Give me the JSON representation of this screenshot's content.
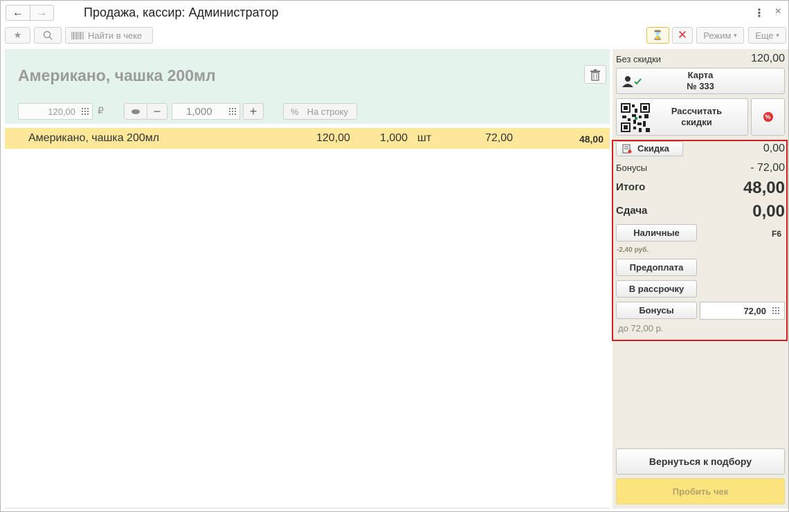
{
  "window": {
    "title": "Продажа, кассир: Администратор",
    "back_icon": "←",
    "forward_icon": "→",
    "menu_icon": "⋮",
    "close_icon": "×"
  },
  "toolbar": {
    "star_icon": "★",
    "search_icon": "search-icon",
    "find_in_receipt": "Найти в чеке",
    "hourglass_icon": "⌛",
    "cancel_icon": "✕",
    "mode": "Режим",
    "more": "Еще",
    "dropdown_icon": "▾"
  },
  "product": {
    "name": "Американо, чашка 200мл",
    "price": "120,00",
    "currency": "₽",
    "quantity": "1,000",
    "minus": "−",
    "plus": "+",
    "percent_icon": "%",
    "per_line": "На строку"
  },
  "receipt": {
    "rows": [
      {
        "name": "Американо, чашка 200мл",
        "price": "120,00",
        "qty": "1,000",
        "unit": "шт",
        "discount": "72,00",
        "sum": "48,00"
      }
    ]
  },
  "summary": {
    "no_discount_label": "Без скидки",
    "no_discount_value": "120,00",
    "card_line1": "Карта",
    "card_line2": "№ 333",
    "calc_line1": "Рассчитать",
    "calc_line2": "скидки",
    "percent_icon": "%",
    "discount_label": "Скидка",
    "discount_value": "0,00",
    "bonuses_label": "Бонусы",
    "bonuses_value": "- 72,00",
    "total_label": "Итого",
    "total_value": "48,00",
    "change_label": "Сдача",
    "change_value": "0,00",
    "cash": "Наличные",
    "cash_hotkey": "F6",
    "cash_hint": "-2,40 руб.",
    "prepayment": "Предоплата",
    "installment": "В рассрочку",
    "bonus_pay": "Бонусы",
    "bonus_amount": "72,00",
    "bonus_hint": "до 72,00 р.",
    "return_to_selection": "Вернуться к подбору",
    "print_receipt": "Пробить чек"
  },
  "colors": {
    "product_panel": "#e4f4ec",
    "selected_row": "#fde89a",
    "right_panel": "#efece3",
    "highlight_border": "#d91c1c",
    "print_button": "#fbe47e"
  }
}
